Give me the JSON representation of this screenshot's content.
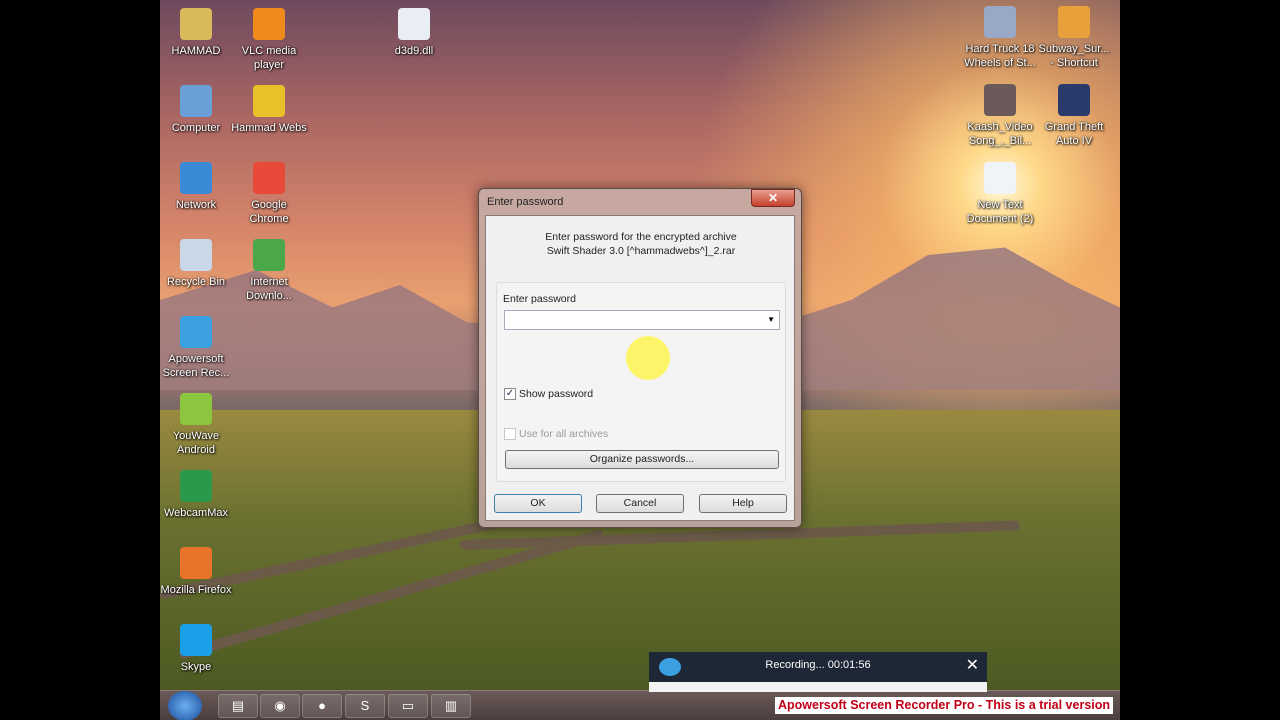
{
  "desktop": {
    "icons_left": [
      {
        "label": "HAMMAD",
        "color": "#d9b95a"
      },
      {
        "label": "Computer",
        "color": "#6aa0d8"
      },
      {
        "label": "Network",
        "color": "#3a8ad8"
      },
      {
        "label": "Recycle Bin",
        "color": "#c8d8e8"
      },
      {
        "label": "Apowersoft Screen Rec...",
        "color": "#3aa0e0"
      },
      {
        "label": "YouWave Android",
        "color": "#8cc63f"
      },
      {
        "label": "WebcamMax",
        "color": "#2a9a4a"
      },
      {
        "label": "Mozilla Firefox",
        "color": "#e8742a"
      },
      {
        "label": "Skype",
        "color": "#1aa0e8"
      }
    ],
    "icons_col2": [
      {
        "label": "VLC media player",
        "color": "#f08a1a"
      },
      {
        "label": "Hammad Webs",
        "color": "#e8c02a"
      },
      {
        "label": "Google Chrome",
        "color": "#e84a3a"
      },
      {
        "label": "Internet Downlo...",
        "color": "#4aa84a"
      }
    ],
    "icons_other": [
      {
        "label": "d3d9.dll",
        "color": "#e8eef4"
      },
      {
        "label": "Hard Truck 18 Wheels of St...",
        "color": "#9aa8c8"
      },
      {
        "label": "Subway_Sur... - Shortcut",
        "color": "#e8a03a"
      },
      {
        "label": "Kaash_Video Song_,_Bil...",
        "color": "#6a5a5a"
      },
      {
        "label": "Grand Theft Auto IV",
        "color": "#2a3a6a"
      },
      {
        "label": "New Text Document (2)",
        "color": "#f0f4f8"
      }
    ]
  },
  "dialog": {
    "title": "Enter password",
    "close": "✕",
    "message_line1": "Enter password for the encrypted archive",
    "message_line2": "Swift Shader 3.0 [^hammadwebs^]_2.rar",
    "field_label": "Enter password",
    "password_value": "",
    "show_password": "Show password",
    "show_password_checked": true,
    "use_for_all": "Use for all archives",
    "use_for_all_checked": false,
    "organize": "Organize passwords...",
    "ok": "OK",
    "cancel": "Cancel",
    "help": "Help"
  },
  "recorder": {
    "status": "Recording... 00:01:56",
    "close": "✕"
  },
  "watermark": "Apowersoft Screen Recorder Pro - This is a trial version"
}
